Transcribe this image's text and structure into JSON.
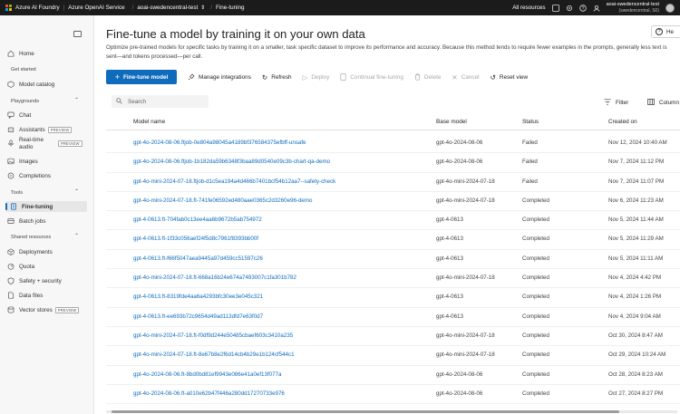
{
  "topbar": {
    "brand": "Azure AI Foundry",
    "service": "Azure OpenAI Service",
    "resource": "aoai-swedencentral-test",
    "page": "Fine-tuning",
    "all_resources": "All resources",
    "account_name": "aoai-swedencentral-test",
    "account_sub": "(swedencentral, S0)"
  },
  "sidebar": {
    "home": "Home",
    "get_started": "Get started",
    "model_catalog": "Model catalog",
    "playgrounds": "Playgrounds",
    "chat": "Chat",
    "assistants": "Assistants",
    "realtime_audio_1": "Real-time",
    "realtime_audio_2": "audio",
    "images": "Images",
    "completions": "Completions",
    "tools": "Tools",
    "fine_tuning": "Fine-tuning",
    "batch_jobs": "Batch jobs",
    "shared_resources": "Shared resources",
    "deployments": "Deployments",
    "quota": "Quota",
    "safety": "Safety + security",
    "data_files": "Data files",
    "vector_stores": "Vector stores",
    "preview": "PREVIEW"
  },
  "main": {
    "title": "Fine-tune a model by training it on your own data",
    "help": "He",
    "description": "Optimize pre-trained models for specific tasks by training it on a smaller, task specific dataset to improve its performance and accuracy. Because this method tends to require fewer examples in the prompts, generally less text is sent—and tokens processed—per call.",
    "toolbar": {
      "fine_tune": "Fine-tune model",
      "manage_integrations": "Manage integrations",
      "refresh": "Refresh",
      "deploy": "Deploy",
      "continual": "Continual fine-tuning",
      "delete": "Delete",
      "cancel": "Cancel",
      "reset_view": "Reset view"
    },
    "search_placeholder": "Search",
    "filter": "Filter",
    "columns": "Column",
    "headers": {
      "name": "Model name",
      "base": "Base model",
      "status": "Status",
      "created": "Created on"
    },
    "rows": [
      {
        "name": "gpt-4o-2024-08-06.ftjob-0e804a98045a4189bf376584375efbff-unsafe",
        "base": "gpt-4o-2024-08-06",
        "status": "Failed",
        "created": "Nov 12, 2024 10:40 AM"
      },
      {
        "name": "gpt-4o-2024-08-06.ftjob-1b182da59b6348f3baa89d0540e09c3b-chart-qa-demo",
        "base": "gpt-4o-2024-08-06",
        "status": "Failed",
        "created": "Nov 7, 2024 11:12 PM"
      },
      {
        "name": "gpt-4o-mini-2024-07-18.ftjob-d1c5ea194a4d466b7401bcf54b12aa7--safety-check",
        "base": "gpt-4o-mini-2024-07-18",
        "status": "Failed",
        "created": "Nov 7, 2024 11:07 PM"
      },
      {
        "name": "gpt-4o-mini-2024-07-18.ft-741fe06592ed480aae0365c2d3260e96-demo",
        "base": "gpt-4o-mini-2024-07-18",
        "status": "Completed",
        "created": "Nov 6, 2024 11:23 AM"
      },
      {
        "name": "gpt-4-0613.ft-704fab0c13ee4aa6b9672b5ab754972",
        "base": "gpt-4-0613",
        "status": "Completed",
        "created": "Nov 5, 2024 11:44 AM"
      },
      {
        "name": "gpt-4-0613.ft-1f33c056aef24f5d8c7961f8393bb00f",
        "base": "gpt-4-0613",
        "status": "Completed",
        "created": "Nov 5, 2024 11:29 AM"
      },
      {
        "name": "gpt-4-0613.ft-f66f5047aea9445a97d459cc51597c26",
        "base": "gpt-4-0613",
        "status": "Completed",
        "created": "Nov 5, 2024 11:11 AM"
      },
      {
        "name": "gpt-4o-mini-2024-07-18.ft-668a16b24e674a7493007c1fa301b782",
        "base": "gpt-4o-mini-2024-07-18",
        "status": "Completed",
        "created": "Nov 4, 2024 4:42 PM"
      },
      {
        "name": "gpt-4-0613.ft-8319fde4aa6a4293bfc30ee3e045c321",
        "base": "gpt-4-0613",
        "status": "Completed",
        "created": "Nov 4, 2024 1:26 PM"
      },
      {
        "name": "gpt-4-0613.ft-ee693b72c9654d49ad113dfd7e63f0d7",
        "base": "gpt-4-0613",
        "status": "Completed",
        "created": "Nov 4, 2024 9:04 AM"
      },
      {
        "name": "gpt-4o-mini-2024-07-18.ft-f0df9d244e50485cbaef603c3410a235",
        "base": "gpt-4o-mini-2024-07-18",
        "status": "Completed",
        "created": "Oct 30, 2024 8:47 AM"
      },
      {
        "name": "gpt-4o-mini-2024-07-18.ft-8e67b8e2f6d14cb4b29e1b124cf544c1",
        "base": "gpt-4o-mini-2024-07-18",
        "status": "Completed",
        "created": "Oct 29, 2024 10:24 AM"
      },
      {
        "name": "gpt-4o-2024-08-06.ft-8bd0bd81ef9943e086e41a0ef13f077a",
        "base": "gpt-4o-2024-08-06",
        "status": "Completed",
        "created": "Oct 28, 2024 8:23 AM"
      },
      {
        "name": "gpt-4o-2024-08-06.ft-a010e62b47f446a280dd17270733e976",
        "base": "gpt-4o-2024-08-06",
        "status": "Completed",
        "created": "Oct 27, 2024 8:27 PM"
      }
    ]
  },
  "colors": {
    "accent": "#0f6cbd",
    "topbar": "#1b1b1b",
    "link": "#0f6cbd"
  }
}
